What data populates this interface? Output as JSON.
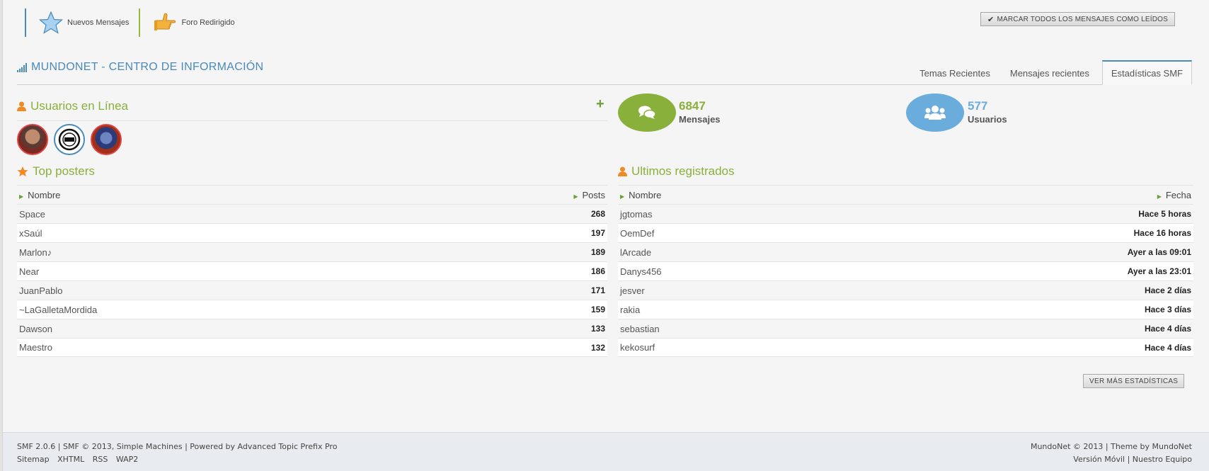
{
  "legend": {
    "new_messages": "Nuevos Mensajes",
    "redirect_forum": "Foro Redirigido",
    "new_messages_icon": "star-icon",
    "redirect_icon": "pointing-hand-icon"
  },
  "mark_all_button": "MARCAR TODOS LOS MENSAJES COMO LEÍDOS",
  "info_center": {
    "title": "MUNDONET - CENTRO DE INFORMACIÓN",
    "tabs": [
      {
        "label": "Temas Recientes",
        "active": false
      },
      {
        "label": "Mensajes recientes",
        "active": false
      },
      {
        "label": "Estadísticas SMF",
        "active": true
      }
    ]
  },
  "online": {
    "title": "Usuarios en Línea",
    "plus": "+"
  },
  "stats": {
    "messages_value": "6847",
    "messages_label": "Mensajes",
    "users_value": "577",
    "users_label": "Usuarios",
    "messages_color": "#8ab03c",
    "users_color": "#6aacdc"
  },
  "top_posters": {
    "title": "Top posters",
    "col_name": "Nombre",
    "col_posts": "Posts",
    "rows": [
      {
        "name": "Space",
        "posts": "268"
      },
      {
        "name": "xSaúl",
        "posts": "197"
      },
      {
        "name": "Marlon♪",
        "posts": "189"
      },
      {
        "name": "Near",
        "posts": "186"
      },
      {
        "name": "JuanPablo",
        "posts": "171"
      },
      {
        "name": "~LaGalletaMordida",
        "posts": "159"
      },
      {
        "name": "Dawson",
        "posts": "133"
      },
      {
        "name": "Maestro",
        "posts": "132"
      }
    ]
  },
  "latest_registered": {
    "title": "Ultimos registrados",
    "col_name": "Nombre",
    "col_date": "Fecha",
    "rows": [
      {
        "name": "jgtomas",
        "date": "Hace 5 horas"
      },
      {
        "name": "OemDef",
        "date": "Hace 16 horas"
      },
      {
        "name": "lArcade",
        "date": "Ayer a las 09:01"
      },
      {
        "name": "Danys456",
        "date": "Ayer a las 23:01"
      },
      {
        "name": "jesver",
        "date": "Hace 2 días"
      },
      {
        "name": "rakia",
        "date": "Hace 3 días"
      },
      {
        "name": "sebastian",
        "date": "Hace 4 días"
      },
      {
        "name": "kekosurf",
        "date": "Hace 4 días"
      }
    ]
  },
  "more_stats_button": "VER MÁS ESTADÍSTICAS",
  "footer": {
    "left_line1": "SMF 2.0.6 | SMF © 2013, Simple Machines | Powered by Advanced Topic Prefix Pro",
    "links": [
      "Sitemap",
      "XHTML",
      "RSS",
      "WAP2"
    ],
    "right_line1": "MundoNet © 2013 | Theme by MundoNet",
    "right_mobile": "Versión Móvil",
    "right_sep": " | ",
    "right_team": "Nuestro Equipo"
  },
  "colors": {
    "accent_blue": "#4a8ab8",
    "accent_green": "#8ab03c",
    "icon_orange": "#f08a24"
  }
}
